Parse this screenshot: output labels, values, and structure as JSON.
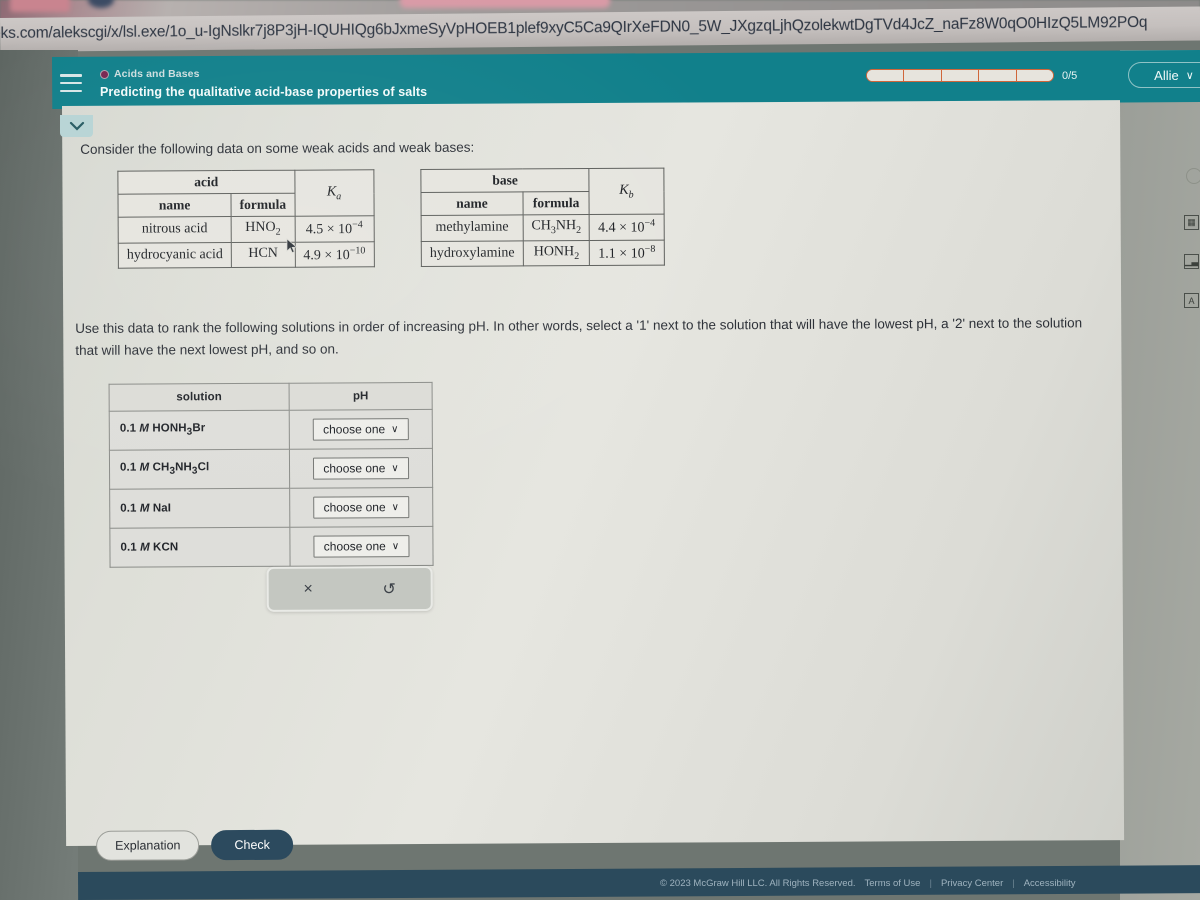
{
  "browser": {
    "url": "eks.com/alekscgi/x/lsl.exe/1o_u-IgNslkr7j8P3jH-IQUHIQg6bJxmeSyVpHOEB1plef9xyC5Ca9QIrXeFDN0_5W_JXgzqLjhQzolekwtDgTVd4JcZ_naFz8W0qO0HIzQ5LM92POq"
  },
  "header": {
    "topic": "Acids and Bases",
    "title": "Predicting the qualitative acid-base properties of salts",
    "progress_label": "0/5",
    "progress_segments": 5,
    "progress_filled": 0,
    "user": "Allie",
    "user_caret": "∨",
    "menu_icon": "hamburger-icon",
    "accent_color": "#11808b",
    "progress_border_color": "#d0663a"
  },
  "content": {
    "prompt_intro": "Consider the following data on some weak acids and weak bases:",
    "prompt_task": "Use this data to rank the following solutions in order of increasing pH. In other words, select a '1' next to the solution that will have the lowest pH, a '2' next to the solution that will have the next lowest pH, and so on."
  },
  "acid_table": {
    "group_header": "acid",
    "k_symbol": "K",
    "k_sub": "a",
    "columns": [
      "name",
      "formula"
    ],
    "rows": [
      {
        "name": "nitrous acid",
        "formula_main": "HNO",
        "formula_sub": "2",
        "k_coeff": "4.5 × 10",
        "k_exp": "−4"
      },
      {
        "name": "hydrocyanic acid",
        "formula_main": "HCN",
        "formula_sub": "",
        "k_coeff": "4.9 × 10",
        "k_exp": "−10"
      }
    ]
  },
  "base_table": {
    "group_header": "base",
    "k_symbol": "K",
    "k_sub": "b",
    "columns": [
      "name",
      "formula"
    ],
    "rows": [
      {
        "name": "methylamine",
        "formula_pre": "CH",
        "formula_sub1": "3",
        "formula_mid": "NH",
        "formula_sub2": "2",
        "k_coeff": "4.4 × 10",
        "k_exp": "−4"
      },
      {
        "name": "hydroxylamine",
        "formula_pre": "HONH",
        "formula_sub1": "2",
        "formula_mid": "",
        "formula_sub2": "",
        "k_coeff": "1.1 × 10",
        "k_exp": "−8"
      }
    ]
  },
  "solution_table": {
    "columns": [
      "solution",
      "pH"
    ],
    "dropdown_placeholder": "choose one",
    "dropdown_caret": "∨",
    "rows": [
      {
        "conc": "0.1",
        "unit": "M",
        "formula_parts": [
          "HONH",
          "3",
          "Br"
        ]
      },
      {
        "conc": "0.1",
        "unit": "M",
        "formula_parts": [
          "CH",
          "3",
          "NH",
          "3",
          "Cl"
        ]
      },
      {
        "conc": "0.1",
        "unit": "M",
        "formula_parts": [
          "NaI"
        ]
      },
      {
        "conc": "0.1",
        "unit": "M",
        "formula_parts": [
          "KCN"
        ]
      }
    ]
  },
  "toolbar": {
    "clear_label": "×",
    "undo_label": "↺"
  },
  "buttons": {
    "explanation": "Explanation",
    "check": "Check"
  },
  "footer": {
    "copyright": "© 2023 McGraw Hill LLC. All Rights Reserved.",
    "terms": "Terms of Use",
    "privacy": "Privacy Center",
    "accessibility": "Accessibility",
    "separator": "|"
  }
}
